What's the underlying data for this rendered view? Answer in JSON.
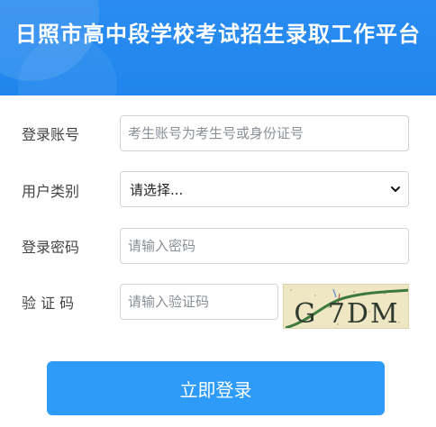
{
  "header": {
    "title": "日照市高中段学校考试招生录取工作平台"
  },
  "form": {
    "account": {
      "label": "登录账号",
      "placeholder": "考生账号为考生号或身份证号"
    },
    "user_type": {
      "label": "用户类别",
      "selected": "请选择..."
    },
    "password": {
      "label": "登录密码",
      "placeholder": "请输入密码"
    },
    "captcha": {
      "label": "验 证 码",
      "placeholder": "请输入验证码",
      "image_text": "G 7DM"
    },
    "submit_label": "立即登录"
  },
  "colors": {
    "header_bg": "#1f86ee",
    "button_bg": "#2d9bf7"
  }
}
